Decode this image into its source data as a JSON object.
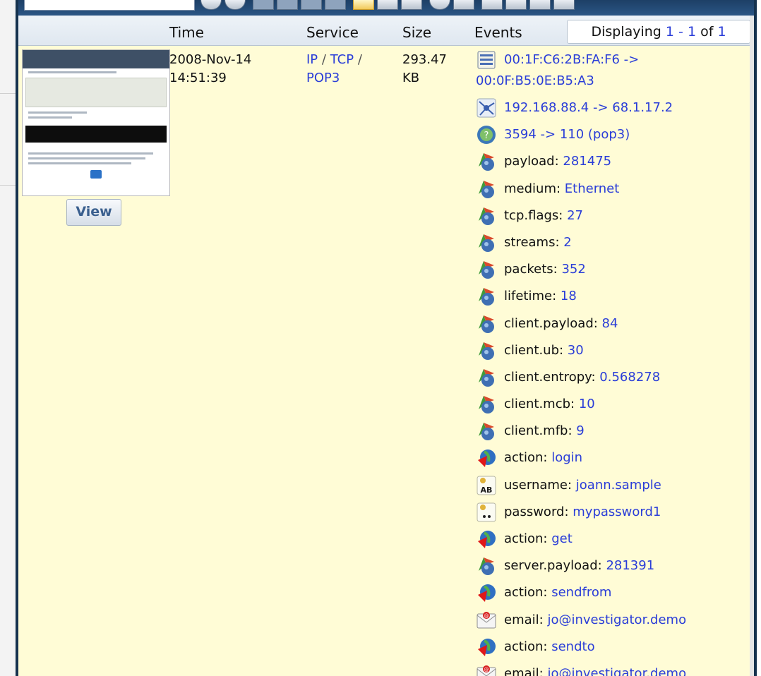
{
  "header": {
    "col_time": "Time",
    "col_service": "Service",
    "col_size": "Size",
    "col_events": "Events",
    "displaying": {
      "prefix": "Displaying",
      "from": "1",
      "dash": "-",
      "to": "1",
      "of": "of",
      "total": "1"
    }
  },
  "session": {
    "date": "2008-Nov-14",
    "time": "14:51:39",
    "service": {
      "p1": "IP",
      "sep1": "/",
      "p2": "TCP",
      "sep2": "/",
      "p3": "POP3"
    },
    "size_value": "293.47",
    "size_unit": "KB",
    "view_label": "View"
  },
  "events": [
    {
      "icon": "mac-address-icon",
      "label": "",
      "value": "00:1F:C6:2B:FA:F6 ->",
      "value2": "00:0F:B5:0E:B5:A3"
    },
    {
      "icon": "ip-address-icon",
      "label": "",
      "value": "192.168.88.4 -> 68.1.17.2"
    },
    {
      "icon": "port-icon",
      "label": "",
      "value": "3594 -> 110 (pop3)"
    },
    {
      "icon": "meta-icon",
      "label": "payload:",
      "value": "281475"
    },
    {
      "icon": "meta-icon",
      "label": "medium:",
      "value": "Ethernet"
    },
    {
      "icon": "meta-icon",
      "label": "tcp.flags:",
      "value": "27"
    },
    {
      "icon": "meta-icon",
      "label": "streams:",
      "value": "2"
    },
    {
      "icon": "meta-icon",
      "label": "packets:",
      "value": "352"
    },
    {
      "icon": "meta-icon",
      "label": "lifetime:",
      "value": "18"
    },
    {
      "icon": "meta-icon",
      "label": "client.payload:",
      "value": "84"
    },
    {
      "icon": "meta-icon",
      "label": "client.ub:",
      "value": "30"
    },
    {
      "icon": "meta-icon",
      "label": "client.entropy:",
      "value": "0.568278"
    },
    {
      "icon": "meta-icon",
      "label": "client.mcb:",
      "value": "10"
    },
    {
      "icon": "meta-icon",
      "label": "client.mfb:",
      "value": "9"
    },
    {
      "icon": "action-icon",
      "label": "action:",
      "value": "login"
    },
    {
      "icon": "username-icon",
      "label": "username:",
      "value": "joann.sample"
    },
    {
      "icon": "password-icon",
      "label": "password:",
      "value": "mypassword1"
    },
    {
      "icon": "action-icon",
      "label": "action:",
      "value": "get"
    },
    {
      "icon": "meta-icon",
      "label": "server.payload:",
      "value": "281391"
    },
    {
      "icon": "action-icon",
      "label": "action:",
      "value": "sendfrom"
    },
    {
      "icon": "email-icon",
      "label": "email:",
      "value": "jo@investigator.demo"
    },
    {
      "icon": "action-icon",
      "label": "action:",
      "value": "sendto"
    },
    {
      "icon": "email-icon",
      "label": "email:",
      "value": "jo@investigator.demo"
    }
  ],
  "colors": {
    "link": "#2a3dd8",
    "row_bg": "#fffcd6",
    "frame": "#16324e"
  }
}
